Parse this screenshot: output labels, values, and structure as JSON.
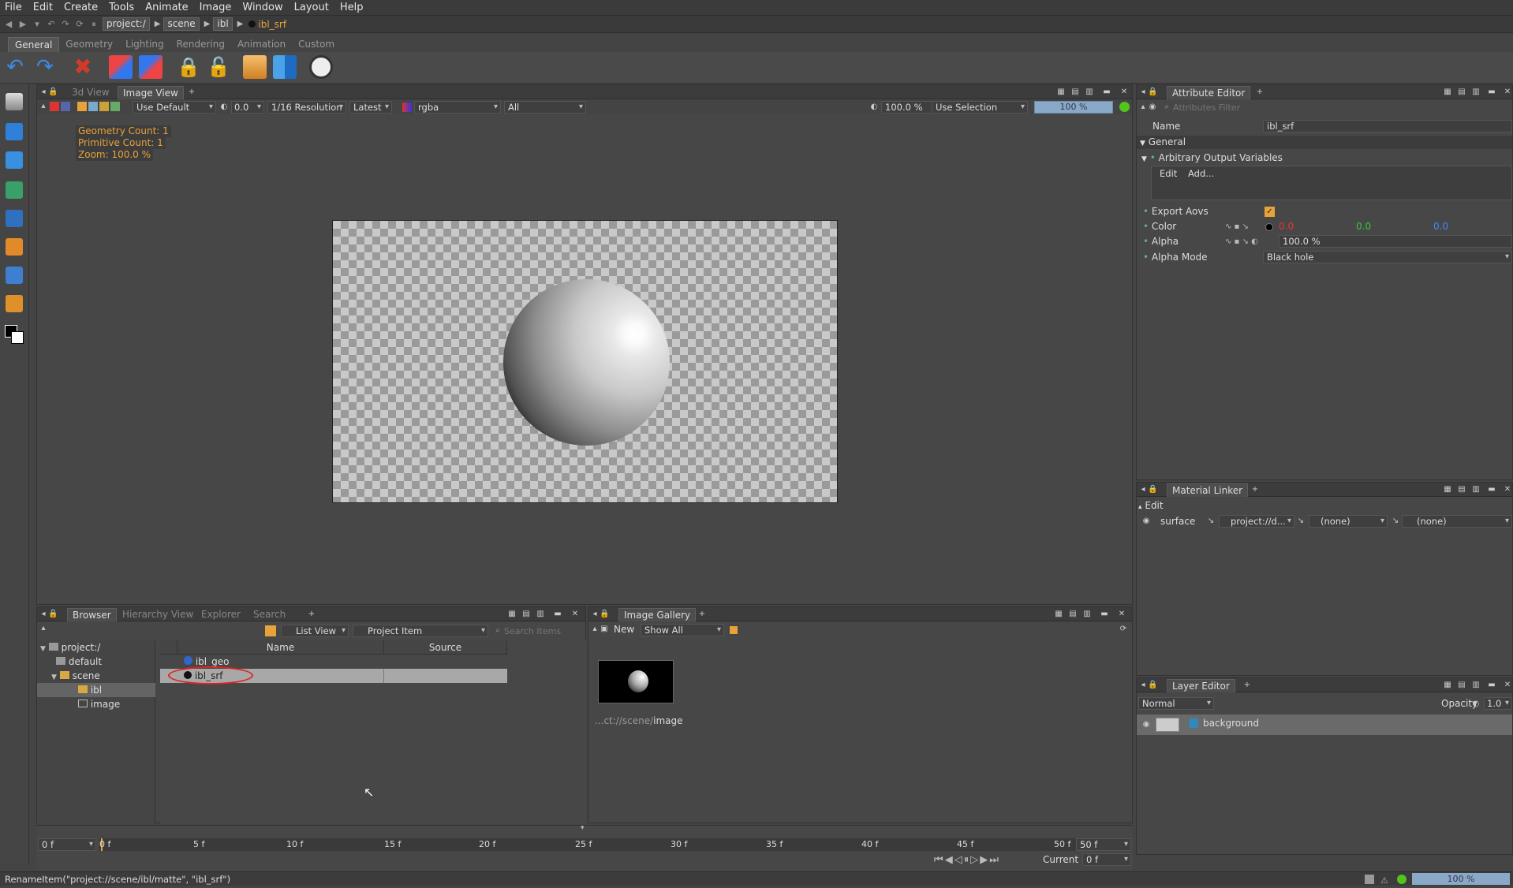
{
  "menu": [
    "File",
    "Edit",
    "Create",
    "Tools",
    "Animate",
    "Image",
    "Window",
    "Layout",
    "Help"
  ],
  "path": {
    "crumbs": [
      "project:/",
      "scene",
      "ibl"
    ],
    "current": "ibl_srf"
  },
  "shelf_tabs": [
    "General",
    "Geometry",
    "Lighting",
    "Rendering",
    "Animation",
    "Custom"
  ],
  "viewer": {
    "tabs": [
      "3d View",
      "Image View"
    ],
    "toolbar": {
      "lut": "Use Default",
      "exposure": "0.0",
      "resolution": "1/16 Resolution",
      "version": "Latest",
      "channels": "rgba",
      "layers": "All",
      "zoom": "100.0 %",
      "selection": "Use Selection",
      "progress": "100 %"
    },
    "overlay": [
      "Geometry Count: 1",
      "Primitive Count: 1",
      "Zoom: 100.0 %"
    ]
  },
  "browser": {
    "tabs": [
      "Browser",
      "Hierarchy View",
      "Explorer",
      "Search"
    ],
    "view_mode": "List View",
    "item_type": "Project Item",
    "search_placeholder": "Search Items",
    "tree": [
      "project:/",
      "default",
      "scene",
      "ibl",
      "image"
    ],
    "columns": [
      "Name",
      "Source"
    ],
    "items": [
      "ibl_geo",
      "ibl_srf"
    ]
  },
  "gallery": {
    "tab": "Image Gallery",
    "new_label": "New",
    "filter": "Show All",
    "caption_prefix": "...ct://scene/",
    "caption_name": "image"
  },
  "timeline": {
    "start": "0 f",
    "end": "50 f",
    "ticks": [
      "0 f",
      "5 f",
      "10 f",
      "15 f",
      "20 f",
      "25 f",
      "30 f",
      "35 f",
      "40 f",
      "45 f",
      "50 f"
    ],
    "current_label": "Current",
    "current": "0 f"
  },
  "attribute_editor": {
    "tab": "Attribute Editor",
    "filter_placeholder": "Attributes Filter",
    "name_label": "Name",
    "name_value": "ibl_srf",
    "section": "General",
    "subsection": "Arbitrary Output Variables",
    "edit_label": "Edit",
    "add_label": "Add...",
    "export_aovs": "Export Aovs",
    "color_label": "Color",
    "color_r": "0.0",
    "color_g": "0.0",
    "color_b": "0.0",
    "alpha_label": "Alpha",
    "alpha_value": "100.0 %",
    "alpha_mode_label": "Alpha Mode",
    "alpha_mode_value": "Black hole"
  },
  "material_linker": {
    "tab": "Material Linker",
    "edit": "Edit",
    "surface": "surface",
    "project": "project://d...",
    "none1": "(none)",
    "none2": "(none)"
  },
  "layer_editor": {
    "tab": "Layer Editor",
    "blend": "Normal",
    "opacity_label": "Opacity",
    "opacity": "1.0",
    "layer": "background"
  },
  "status": {
    "message": "RenameItem(\"project://scene/ibl/matte\", \"ibl_srf\")",
    "zoom": "100 %"
  }
}
